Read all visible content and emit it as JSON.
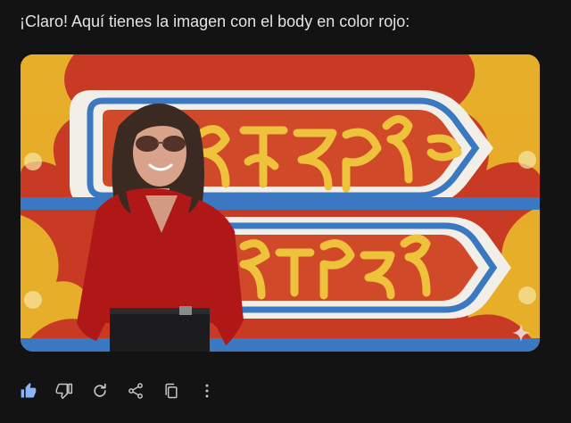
{
  "message": {
    "text": "¡Claro! Aquí tienes la imagen con el body en color rojo:"
  },
  "image": {
    "colors": {
      "wall_red": "#c83a24",
      "panel_white": "#f2efe9",
      "panel_blue": "#3a78c2",
      "gold": "#e9b42a",
      "body_red": "#b01818",
      "pants": "#1c1c1e",
      "hair": "#3b2a22",
      "skin": "#d9a38b"
    }
  },
  "actions": {
    "icons": [
      "thumb-up-icon",
      "thumb-down-icon",
      "regenerate-icon",
      "share-icon",
      "copy-icon",
      "more-vert-icon"
    ],
    "thumb_up_color": "#8ab4f8",
    "icon_color": "#c4c7c5"
  }
}
